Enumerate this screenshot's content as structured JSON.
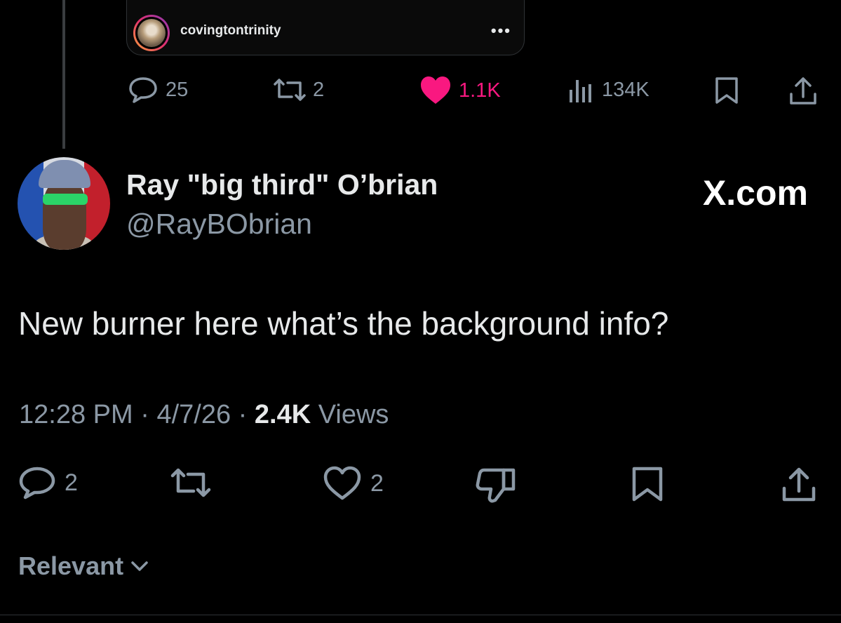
{
  "embed": {
    "username": "covingtontrinity",
    "more_label": "•••"
  },
  "parent_stats": {
    "replies": "25",
    "reposts": "2",
    "likes": "1.1K",
    "views": "134K"
  },
  "tweet": {
    "display_name": "Ray \"big third\" O’brian",
    "handle": "@RayBObrian",
    "watermark": "X.com",
    "text": "New burner here what’s the background info?",
    "time": "12:28 PM",
    "separator": "·",
    "date": "4/7/26",
    "views_count": "2.4K",
    "views_label": "Views"
  },
  "actions": {
    "replies": "2",
    "likes": "2"
  },
  "sort": {
    "label": "Relevant"
  },
  "colors": {
    "background": "#000000",
    "text_primary": "#e7e9ea",
    "text_secondary": "#8b98a5",
    "like_active": "#f91880",
    "divider": "#2f3336"
  },
  "icons": [
    "reply-icon",
    "repost-icon",
    "heart-icon",
    "views-icon",
    "bookmark-icon",
    "share-icon",
    "dislike-icon",
    "chevron-down-icon"
  ]
}
